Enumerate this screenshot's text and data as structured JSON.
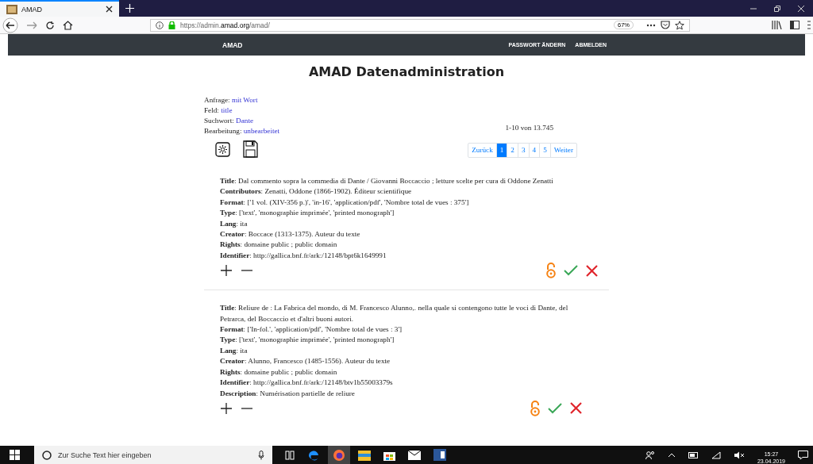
{
  "browser": {
    "tab_title": "AMAD",
    "url": "https://admin.**amad.org**/amad/",
    "zoom": "67%"
  },
  "navbar": {
    "brand": "AMAD",
    "links": [
      "PASSWORT ÄNDERN",
      "ABMELDEN"
    ]
  },
  "page_title": "AMAD Datenadministration",
  "query": [
    {
      "label": "Anfrage:",
      "value": "mit Wort"
    },
    {
      "label": "Feld:",
      "value": "title"
    },
    {
      "label": "Suchwort:",
      "value": "Dante"
    },
    {
      "label": "Bearbeitung:",
      "value": "unbearbeitet"
    }
  ],
  "result_count": "1-10 von 13.745",
  "pagination": [
    {
      "label": "Zurück",
      "selected": false
    },
    {
      "label": "1",
      "selected": true
    },
    {
      "label": "2",
      "selected": false
    },
    {
      "label": "3",
      "selected": false
    },
    {
      "label": "4",
      "selected": false
    },
    {
      "label": "5",
      "selected": false
    },
    {
      "label": "Weiter",
      "selected": false
    }
  ],
  "records": [
    {
      "fields": [
        {
          "label": "Title",
          "value": ": Dal commento sopra la commedia di Dante / Giovanni Boccaccio ; letture scelte per cura di Oddone Zenatti"
        },
        {
          "label": "Contributors",
          "value": ": Zenatti, Oddone (1866-1902). Éditeur scientifique"
        },
        {
          "label": "Format",
          "value": ": ['1 vol. (XIV-356 p.)', 'in-16', 'application/pdf', 'Nombre total de vues : 375']"
        },
        {
          "label": "Type",
          "value": ": ['text', 'monographie imprimée', 'printed monograph']"
        },
        {
          "label": "Lang",
          "value": ": ita"
        },
        {
          "label": "Creator",
          "value": ": Boccace (1313-1375). Auteur du texte"
        },
        {
          "label": "Rights",
          "value": ": domaine public ; public domain"
        },
        {
          "label": "Identifier",
          "value": ": http://gallica.bnf.fr/ark:/12148/bpt6k1649991"
        }
      ]
    },
    {
      "fields": [
        {
          "label": "Title",
          "value": ": Reliure de : La Fabrica del mondo, di M. Francesco Alunno,. nella quale si contengono tutte le voci di Dante, del Petrarca, del Boccaccio et d'altri buoni autori."
        },
        {
          "label": "Format",
          "value": ": ['In-fol.', 'application/pdf', 'Nombre total de vues : 3']"
        },
        {
          "label": "Type",
          "value": ": ['text', 'monographie imprimée', 'printed monograph']"
        },
        {
          "label": "Lang",
          "value": ": ita"
        },
        {
          "label": "Creator",
          "value": ": Alunno, Francesco (1485-1556). Auteur du texte"
        },
        {
          "label": "Rights",
          "value": ": domaine public ; public domain"
        },
        {
          "label": "Identifier",
          "value": ": http://gallica.bnf.fr/ark:/12148/btv1b55003379s"
        },
        {
          "label": "Description",
          "value": ": Numérisation partielle de reliure"
        }
      ]
    }
  ],
  "taskbar": {
    "search_placeholder": "Zur Suche Text hier eingeben",
    "time": "15:27",
    "date": "23.04.2019"
  }
}
